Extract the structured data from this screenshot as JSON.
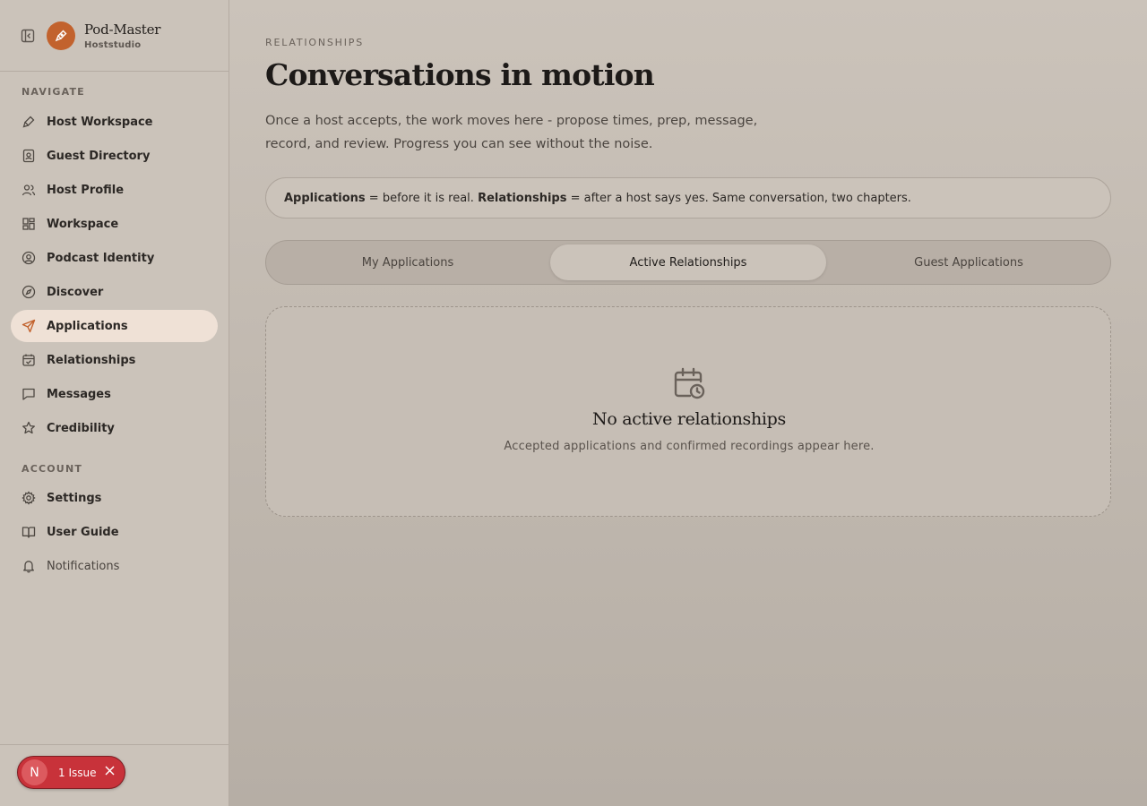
{
  "app": {
    "name": "Pod-Master",
    "subtitle": "Hoststudio",
    "accent_color": "#c2622d"
  },
  "sidebar": {
    "navigate_label": "NAVIGATE",
    "account_label": "ACCOUNT",
    "nav_items": [
      {
        "label": "Host Workspace",
        "icon": "pen-nib-icon"
      },
      {
        "label": "Guest Directory",
        "icon": "contact-book-icon"
      },
      {
        "label": "Host Profile",
        "icon": "users-icon"
      },
      {
        "label": "Workspace",
        "icon": "dashboard-icon"
      },
      {
        "label": "Podcast Identity",
        "icon": "user-circle-icon"
      },
      {
        "label": "Discover",
        "icon": "compass-icon"
      },
      {
        "label": "Applications",
        "icon": "send-icon",
        "active": true
      },
      {
        "label": "Relationships",
        "icon": "calendar-check-icon"
      },
      {
        "label": "Messages",
        "icon": "message-square-icon"
      },
      {
        "label": "Credibility",
        "icon": "star-icon"
      }
    ],
    "account_items": [
      {
        "label": "Settings",
        "icon": "gear-icon"
      },
      {
        "label": "User Guide",
        "icon": "book-open-icon"
      },
      {
        "label": "Notifications",
        "icon": "bell-icon"
      }
    ]
  },
  "issue_badge": {
    "avatar_letter": "N",
    "text": "1 Issue",
    "color": "#c8323a"
  },
  "main": {
    "eyebrow": "RELATIONSHIPS",
    "title": "Conversations in motion",
    "description": "Once a host accepts, the work moves here - propose times, prep, message, record, and review. Progress you can see without the noise.",
    "info": {
      "term1": "Applications",
      "def1": " = before it is real. ",
      "term2": "Relationships",
      "def2": " = after a host says yes. Same conversation, two chapters."
    },
    "tabs": [
      {
        "label": "My Applications"
      },
      {
        "label": "Active Relationships",
        "active": true
      },
      {
        "label": "Guest Applications"
      }
    ],
    "empty_state": {
      "icon": "calendar-clock-icon",
      "title": "No active relationships",
      "subtitle": "Accepted applications and confirmed recordings appear here."
    }
  }
}
